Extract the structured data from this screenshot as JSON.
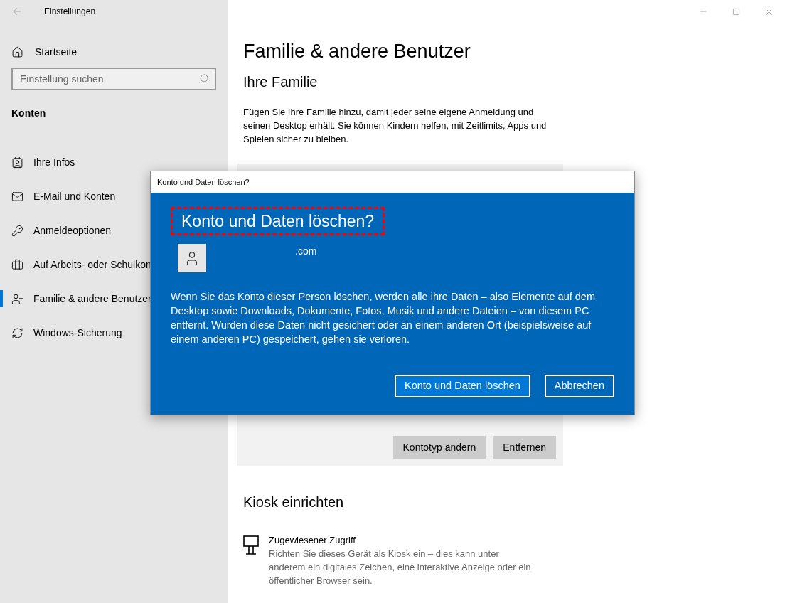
{
  "window": {
    "title": "Einstellungen"
  },
  "sidebar": {
    "home": "Startseite",
    "search": {
      "placeholder": "Einstellung suchen"
    },
    "section": "Konten",
    "items": [
      {
        "label": "Ihre Infos",
        "selected": false
      },
      {
        "label": "E-Mail und Konten",
        "selected": false
      },
      {
        "label": "Anmeldeoptionen",
        "selected": false
      },
      {
        "label": "Auf Arbeits- oder Schulkon",
        "selected": false
      },
      {
        "label": "Familie & andere Benutzer",
        "selected": true
      },
      {
        "label": "Windows-Sicherung",
        "selected": false
      }
    ]
  },
  "main": {
    "title": "Familie & andere Benutzer",
    "family_heading": "Ihre Familie",
    "family_text": "Fügen Sie Ihre Familie hinzu, damit jeder seine eigene Anmeldung und seinen Desktop erhält. Sie können Kindern helfen, mit Zeitlimits, Apps und Spielen sicher zu bleiben.",
    "card_buttons": [
      "Kontotyp ändern",
      "Entfernen"
    ],
    "kiosk_heading": "Kiosk einrichten",
    "kiosk_item": {
      "title": "Zugewiesener Zugriff",
      "description": "Richten Sie dieses Gerät als Kiosk ein – dies kann unter anderem ein digitales Zeichen, eine interaktive Anzeige oder ein öffentlicher Browser sein."
    }
  },
  "dialog": {
    "title": "Konto und Daten löschen?",
    "heading": "Konto und Daten löschen?",
    "email": ".com",
    "message": "Wenn Sie das Konto dieser Person löschen, werden alle ihre Daten – also Elemente auf dem Desktop sowie Downloads, Dokumente, Fotos, Musik und andere Dateien – von diesem PC entfernt. Wurden diese Daten nicht gesichert oder an einem anderen Ort (beispielsweise auf einem anderen PC) gespeichert, gehen sie verloren.",
    "buttons": [
      {
        "label": "Konto und Daten löschen",
        "kind": "primary"
      },
      {
        "label": "Abbrechen",
        "kind": "secondary"
      }
    ]
  }
}
